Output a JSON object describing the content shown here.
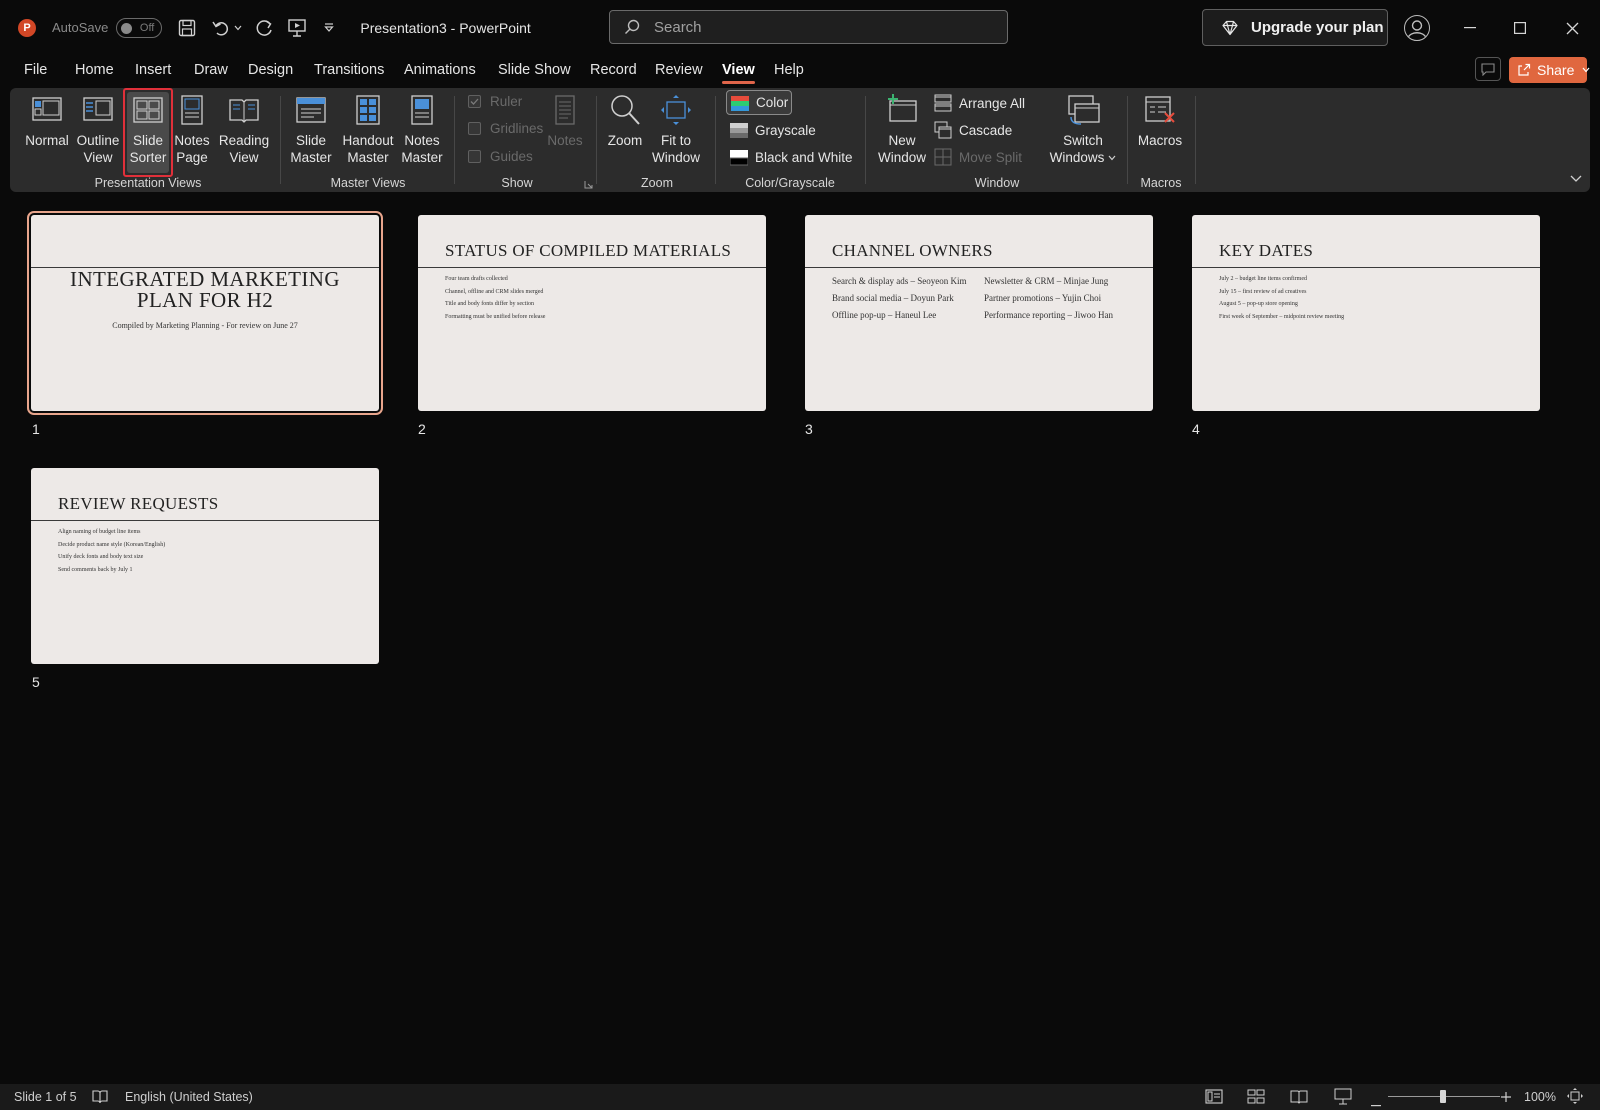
{
  "app": {
    "autosave_label": "AutoSave",
    "autosave_state": "Off",
    "doc_title": "Presentation3  -  PowerPoint",
    "search_placeholder": "Search",
    "upgrade_label": "Upgrade your plan",
    "accent": "#e0673f"
  },
  "menu": {
    "tabs": [
      "File",
      "Home",
      "Insert",
      "Draw",
      "Design",
      "Transitions",
      "Animations",
      "Slide Show",
      "Record",
      "Review",
      "View",
      "Help"
    ],
    "active": "View",
    "share_label": "Share"
  },
  "ribbon": {
    "presentation_views": {
      "label": "Presentation Views",
      "normal": "Normal",
      "outline_1": "Outline",
      "outline_2": "View",
      "sorter_1": "Slide",
      "sorter_2": "Sorter",
      "notes_1": "Notes",
      "notes_2": "Page",
      "reading_1": "Reading",
      "reading_2": "View"
    },
    "master_views": {
      "label": "Master Views",
      "slide_1": "Slide",
      "slide_2": "Master",
      "handout_1": "Handout",
      "handout_2": "Master",
      "notes_1": "Notes",
      "notes_2": "Master"
    },
    "show": {
      "label": "Show",
      "ruler": "Ruler",
      "gridlines": "Gridlines",
      "guides": "Guides",
      "notes": "Notes"
    },
    "zoom": {
      "label": "Zoom",
      "zoom": "Zoom",
      "fit_1": "Fit to",
      "fit_2": "Window"
    },
    "color": {
      "label": "Color/Grayscale",
      "color": "Color",
      "grayscale": "Grayscale",
      "bw": "Black and White"
    },
    "window": {
      "label": "Window",
      "new_1": "New",
      "new_2": "Window",
      "arrange": "Arrange All",
      "cascade": "Cascade",
      "move_split": "Move Split",
      "switch_1": "Switch",
      "switch_2": "Windows"
    },
    "macros": {
      "label": "Macros",
      "macros": "Macros"
    }
  },
  "slides": [
    {
      "num": "1",
      "title_1": "INTEGRATED MARKETING",
      "title_2": "PLAN FOR H2",
      "subtitle": "Compiled by Marketing Planning - For review on June 27"
    },
    {
      "num": "2",
      "title": "STATUS OF COMPILED MATERIALS",
      "bullets": [
        "Four team drafts collected",
        "Channel, offline and CRM slides merged",
        "Title and body fonts differ by section",
        "Formatting must be unified before release"
      ]
    },
    {
      "num": "3",
      "title": "CHANNEL OWNERS",
      "left": [
        "Search & display ads – Seoyeon Kim",
        "Brand social media – Doyun Park",
        "Offline pop-up – Haneul Lee"
      ],
      "right": [
        "Newsletter & CRM – Minjae Jung",
        "Partner promotions – Yujin Choi",
        "Performance reporting – Jiwoo Han"
      ]
    },
    {
      "num": "4",
      "title": "KEY DATES",
      "bullets": [
        "July 2 – budget line items confirmed",
        "July 15 – first review of ad creatives",
        "August 5 – pop-up store opening",
        "First week of September – midpoint review meeting"
      ]
    },
    {
      "num": "5",
      "title": "REVIEW REQUESTS",
      "bullets": [
        "Align naming of budget line items",
        "Decide product name style (Korean/English)",
        "Unify deck fonts and body text size",
        "Send comments back by July 1"
      ]
    }
  ],
  "status": {
    "slide_info": "Slide 1 of 5",
    "language": "English (United States)",
    "zoom": "100%",
    "zoom_level_fraction": 0.5
  }
}
